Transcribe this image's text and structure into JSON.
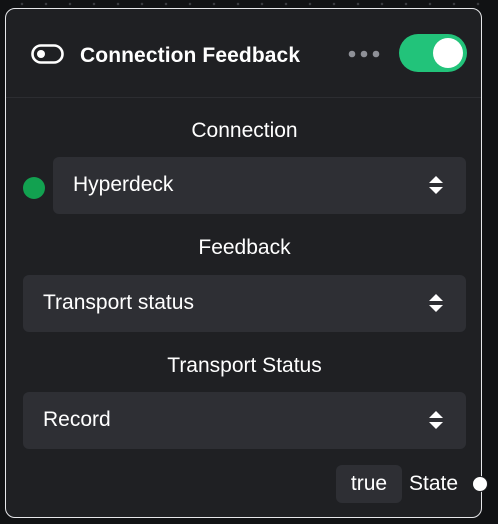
{
  "node": {
    "title": "Connection Feedback",
    "icon": "toggle-icon",
    "enabled": true,
    "accent_color": "#22c37a"
  },
  "connection": {
    "label": "Connection",
    "value": "Hyperdeck",
    "status_color": "#12a150"
  },
  "feedback": {
    "label": "Feedback",
    "value": "Transport status"
  },
  "transport_status": {
    "label": "Transport Status",
    "value": "Record"
  },
  "output": {
    "value": "true",
    "label": "State"
  }
}
